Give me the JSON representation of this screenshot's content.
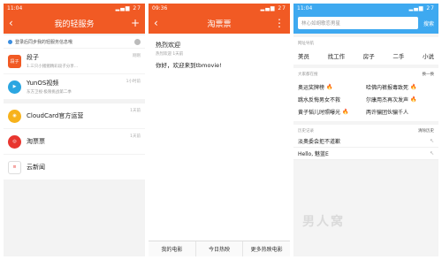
{
  "colors": {
    "accent": "#f15a24",
    "search": "#3ea9f0"
  },
  "panel1": {
    "status": {
      "time": "11:04",
      "battery": "27"
    },
    "title": "我的轻服务",
    "add_icon": "plus-icon",
    "notice": "登录后同步我的轻服务信息哦",
    "items": [
      {
        "name": "段子",
        "icon_text": "段子",
        "sub": "1.三只小猪猪精彩段子分享...",
        "time": "刚刚"
      },
      {
        "name": "YunOS视频",
        "icon_text": "",
        "sub": "东方卫视·极限挑战第二季",
        "time": "1小时前"
      },
      {
        "name": "CloudCard官方运营",
        "icon_text": "",
        "sub": "",
        "time": "1天前"
      },
      {
        "name": "淘票票",
        "icon_text": "",
        "sub": "",
        "time": "1天前"
      },
      {
        "name": "云新闻",
        "icon_text": "",
        "sub": "",
        "time": ""
      }
    ]
  },
  "panel2": {
    "status": {
      "time": "09:36",
      "battery": "27"
    },
    "title": "淘票票",
    "msg_title": "热烈欢迎",
    "msg_date": "热烈欢迎  1天前",
    "msg_body": "你好，欢迎来到tbmovie!",
    "tabs": [
      "我的电影",
      "今日热映",
      "更多热映电影"
    ]
  },
  "panel3": {
    "status": {
      "time": "11:04",
      "battery": "27"
    },
    "search_placeholder": "林心如胡歌恋男星",
    "search_button": "搜索",
    "cats_head": "网址导航",
    "cats": [
      "美员",
      "找工作",
      "房子",
      "二手",
      "小说"
    ],
    "hot_head": "大家都在搜",
    "hot_more": "换一换",
    "hot": [
      {
        "text": "奥运奖牌榜",
        "fire": true
      },
      {
        "text": "哈佛内裤报毒致死",
        "fire": true
      },
      {
        "text": "跳水反悔男女不救",
        "fire": false
      },
      {
        "text": "尔康用杰再次发声",
        "fire": true
      },
      {
        "text": "黄子韬儿时照曝光",
        "fire": true
      },
      {
        "text": "两许骗团伙骗千人",
        "fire": false
      }
    ],
    "hist_head": "历史记录",
    "hist_clear": "清除历史",
    "history": [
      "淡奥委会拒不道歉",
      "Hello, 魅蓝E"
    ]
  },
  "watermark": "男人窝"
}
